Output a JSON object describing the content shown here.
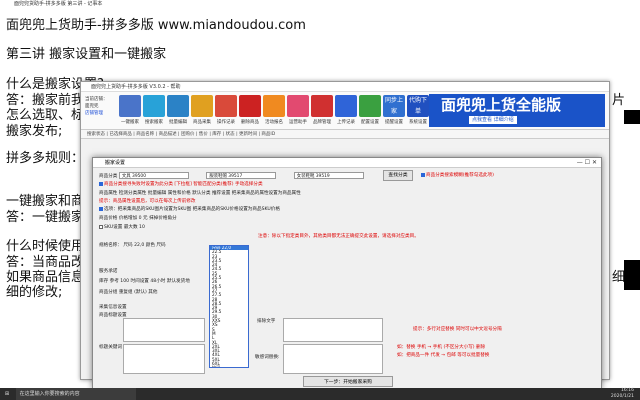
{
  "doc": {
    "tab_title": "面兜兜货助手-拼多多版 第三讲 - 记事本",
    "heading": "面兜兜上货助手-拼多多版 www.miandoudou.com",
    "section": "第三讲 搬家设置和一键搬家",
    "q1": "什么是搬家设置?",
    "a1a": "答：搬家前我们",
    "a1_right": "片",
    "a1b": "怎么选取、标题",
    "a1c": "搬家发布;",
    "rules": "拼多多规则：团",
    "one_click": "一键搬家和商品",
    "a2": "答：一键搬家就",
    "when": "什么时候使用一",
    "a3": "答：当商品改动",
    "a3_right": "细",
    "a3b": "如果商品信息改",
    "a3c": "细的修改;"
  },
  "app": {
    "title": "面兜兜上货助手-拼多多版 V3.0.2 - 帮助",
    "toolbar_left": [
      "当前店铺：",
      "面兜兜",
      "店铺管理"
    ],
    "buttons": [
      "一键搬家",
      "搜索搬家",
      "批量编辑",
      "商品采集",
      "操作记录",
      "删除商品",
      "活动报名",
      "运营助手",
      "品牌管理",
      "上传记录",
      "配置设置",
      "提醒设置",
      "系统设置"
    ],
    "sync_button": "同步上家",
    "proxy_button": "代购下单",
    "banner": "面兜兜上货全能版",
    "banner_sub": "点我查看 详细介绍",
    "filter": "搜索状态 | 已选择商品 | 商品名称 | 商品描述 | 团购价 | 售价 | 库存 | 状态 | 更新时间 | 商品ID"
  },
  "dialog": {
    "title": "搬家设置",
    "cat_label": "商品分类",
    "cat_values": [
      "文具 39500",
      "服装鞋帽 39517",
      "女装鞋靴 39519"
    ],
    "cat_btn": "查找分类",
    "cat_check": "商品分类搜索模糊(推荐勾选此项)",
    "r1": "商品分类搜寻失败时设置为此分类 [下拉框]  智能匹配分类(推荐) 手动选择分类",
    "r2": "商品属性 检测分类属性 批量编辑 属性和价格  默认分类 推荐设置 把采集商品的属性设置为商品属性",
    "r3": "提示：商品属性设置后，可以在每次上传前修改",
    "r4": "选项：把采集商品的SKU图片设置为SKU图  把采集商品的SKU价格设置为商品SKU价格",
    "r5": "商品价格  价格增加 0  元 抹掉价格角分",
    "r6": "SKU设置  最大数 10",
    "r7": "规格名称：  尺码 22,0  颜色 尺码 ",
    "r8": "服务承诺",
    "r9": "库存 参考 100  时间设置 48小时  默认发货地",
    "r10": "商品分组 重复组 (默认) 其他",
    "r11": "采集信息设置",
    "left_lbl": "商品标题设置",
    "left_lbl2": "标题关键词",
    "right_lbl": "排除文字",
    "right_lbl2": "敏感词替换:",
    "hint1": "提示：多行对应替换 同时可以中文逗号分隔",
    "hint2": "如：替换 手机 → 手机 (不区分大小写) 删除",
    "hint3": "如：把商品一件 代发 → 包邮 等可以批量替换",
    "next_btn": "下一步：开始搬家采购",
    "red_note": "注意：除以下指定类目外，其他类目都无法正确提交此设置，请选择对应类目。"
  },
  "dropdown": [
    "尺码 22,0",
    "22.5",
    "23",
    "23.5",
    "24",
    "24.5",
    "25",
    "25.5",
    "26",
    "26.5",
    "27",
    "27.5",
    "28",
    "28.5",
    "29",
    "29.5",
    "30",
    "XXS",
    "XS",
    "S",
    "M",
    "L",
    "XL",
    "2XL",
    "3XL",
    "4XL",
    "5XL",
    "6XL",
    "均码",
    "35",
    "36",
    "37",
    "38"
  ],
  "taskbar": {
    "search": "在这里输入你要搜索的内容",
    "time": "16:16",
    "date": "2020/1/21"
  }
}
